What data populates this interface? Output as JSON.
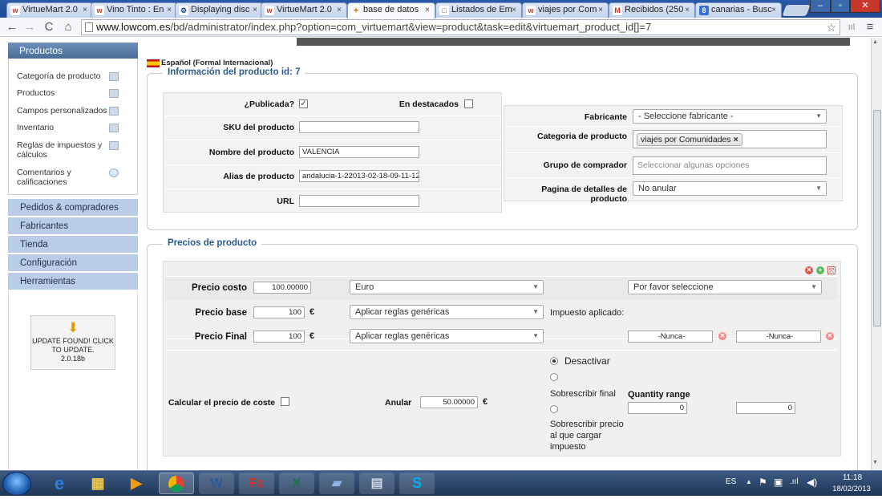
{
  "browser": {
    "tabs": [
      {
        "label": "VirtueMart 2.0",
        "favicon": "w",
        "fav_color": "#c0392b",
        "fav_bg": "#fff"
      },
      {
        "label": "Vino Tinto : En",
        "favicon": "w",
        "fav_color": "#c0392b",
        "fav_bg": "#fff"
      },
      {
        "label": "Displaying disc",
        "favicon": "⚙",
        "fav_color": "#1a4c8b",
        "fav_bg": "#fff"
      },
      {
        "label": "VirtueMart 2.0",
        "favicon": "w",
        "fav_color": "#c0392b",
        "fav_bg": "#fff"
      },
      {
        "label": "base de datos",
        "favicon": "✦",
        "fav_color": "#e67e22",
        "fav_bg": "#fff",
        "active": true
      },
      {
        "label": "Listados de Em",
        "favicon": "□",
        "fav_color": "#666",
        "fav_bg": "#fff"
      },
      {
        "label": "viajes por Com",
        "favicon": "w",
        "fav_color": "#c0392b",
        "fav_bg": "#fff"
      },
      {
        "label": "Recibidos (250",
        "favicon": "M",
        "fav_color": "#d93025",
        "fav_bg": "#fff"
      },
      {
        "label": "canarias - Busc",
        "favicon": "8",
        "fav_color": "#fff",
        "fav_bg": "#3b6fd4"
      }
    ],
    "close_glyph": "×",
    "url_host": "www.lowcom.es",
    "url_path": "/bd/administrator/index.php?option=com_virtuemart&view=product&task=edit&virtuemart_product_id[]=7",
    "window_controls": [
      "–",
      "▫",
      "✕"
    ]
  },
  "sidebar": {
    "header": "Productos",
    "items": [
      {
        "label": "Categoría de producto"
      },
      {
        "label": "Productos"
      },
      {
        "label": "Campos personalizados"
      },
      {
        "label": "Inventario"
      },
      {
        "label": "Reglas de impuestos y cálculos"
      },
      {
        "label": "Comentarios y calificaciones"
      }
    ],
    "sections": [
      "Pedidos & compradores",
      "Fabricantes",
      "Tienda",
      "Configuración",
      "Herramientas"
    ],
    "update_text": "UPDATE FOUND! CLICK TO UPDATE.",
    "update_version": "2.0.18b"
  },
  "product": {
    "language": "Español (Formal Internacional)",
    "legend": "Información del producto id: 7",
    "published_label": "¿Publicada?",
    "published_checked": "✓",
    "featured_label": "En destacados",
    "sku_label": "SKU del producto",
    "sku_value": "",
    "name_label": "Nombre del producto",
    "name_value": "VALENCIA",
    "alias_label": "Alias de producto",
    "alias_value": "andalucia-1-22013-02-18-09-11-12",
    "url_label": "URL",
    "url_value": "",
    "manufacturer_label": "Fabricante",
    "manufacturer_value": "- Seleccione fabricante -",
    "category_label": "Categoria de producto",
    "category_chip": "viajes por Comunidades",
    "chip_remove": "×",
    "group_label": "Grupo de comprador",
    "group_placeholder": "Seleccionar algunas opciones",
    "details_label": "Pagina de detalles de producto",
    "details_value": "No anular"
  },
  "prices": {
    "legend": "Precios de producto",
    "cost_label": "Precio costo",
    "cost_value": "100.00000",
    "currency_value": "Euro",
    "shopper_value": "Por favor seleccione",
    "base_label": "Precio base",
    "base_value": "100",
    "euro_symbol": "€",
    "base_rule": "Aplicar reglas genéricas",
    "tax_applied_label": "Impuesto aplicado:",
    "final_label": "Precio Final",
    "final_value": "100",
    "final_rule": "Aplicar reglas genéricas",
    "date_from": "-Nunca-",
    "date_to": "-Nunca-",
    "option_disable": "Desactivar",
    "option_override": "Sobrescribir final",
    "option_override_tax": "Sobrescribir precio al que cargar impuesto",
    "calc_cost_label": "Calcular el precio de coste",
    "cancel_label": "Anular",
    "cancel_value": "50.00000",
    "quantity_label": "Quantity range",
    "qty_start": "0",
    "qty_end": "0"
  },
  "taskbar": {
    "language": "ES",
    "time": "11:18",
    "date": "18/02/2013"
  }
}
